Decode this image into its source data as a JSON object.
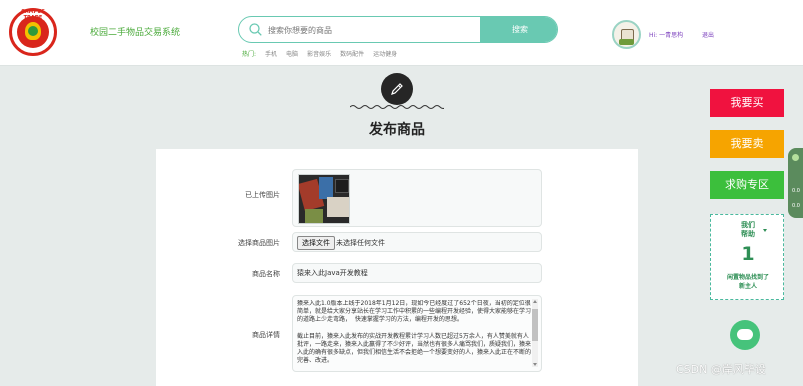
{
  "header": {
    "site_title": "校园二手物品交易系统",
    "logo_text": "CAMPUS TRADE",
    "search": {
      "placeholder": "搜索你想要的商品",
      "button": "搜索"
    },
    "hot": {
      "label": "热门:",
      "items": [
        "手机",
        "电脑",
        "影音娱乐",
        "数码配件",
        "运动健身"
      ]
    },
    "user": {
      "greeting": "Hi:  一青思构",
      "logout": "退出"
    }
  },
  "page": {
    "title": "发布商品"
  },
  "form": {
    "uploaded_image_label": "已上传图片",
    "choose_image_label": "选择商品图片",
    "choose_file_button": "选择文件",
    "file_status": "未选择任何文件",
    "name_label": "商品名称",
    "name_value": "猿来入此Java开发教程",
    "detail_label": "商品详情",
    "detail_value": "猿来入此1.0版本上线于2018年1月12日，现如今已经度过了652个日夜，当初的定位很简单，就是给大家分享站长在学习工作中积累的一些编程开发经验，使得大家能够在学习的道路上少走弯路，  快速掌握学习的方法，编程开发的思想。\n\n截止目前，猿来入此发布的实战开发教程累计学习人数已超过5万余人，有人赞美就有人批评，一路走来，猿来入此赢得了不少好评，当然也有很多人痛骂我们，质疑我们，猿来入此的确有很多缺点，但我们相信生活不会拒绝一个想要变好的人，猿来入此正在不断的完善、改进。"
  },
  "sidebar": {
    "buy": "我要买",
    "sell": "我要卖",
    "zone": "求购专区",
    "help": {
      "title_line1": "我们",
      "title_line2": "帮助",
      "count": "1",
      "sub_line1": "闲置物品找到了",
      "sub_line2": "新主人"
    }
  },
  "edge_widget": {
    "line1": "0.0",
    "line2": "0.0"
  },
  "watermark": "CSDN @岸风毕设",
  "colors": {
    "accent": "#69c9b2",
    "buy": "#f0123f",
    "sell": "#f6a400",
    "zone": "#3cbf3c"
  }
}
